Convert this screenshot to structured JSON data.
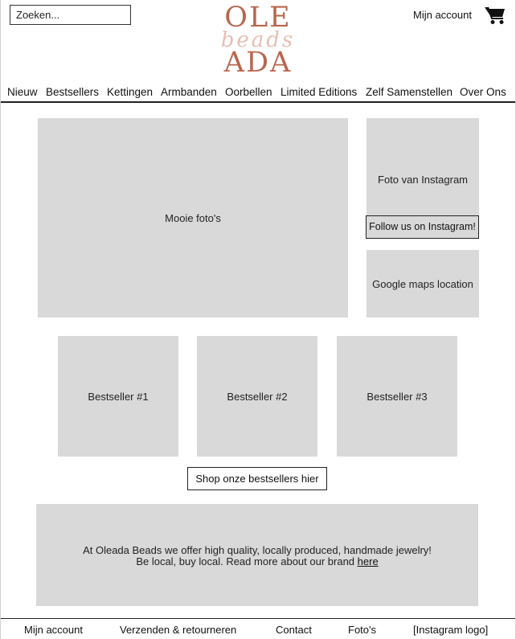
{
  "header": {
    "search": {
      "placeholder": "Zoeken..."
    },
    "logo": {
      "top": "OLE",
      "script": "beads",
      "bottom": "ADA"
    },
    "account_label": "Mijn account",
    "cart_icon": "shopping-cart-icon"
  },
  "nav": {
    "items": [
      {
        "label": "Nieuw"
      },
      {
        "label": "Bestsellers"
      },
      {
        "label": "Kettingen"
      },
      {
        "label": "Armbanden"
      },
      {
        "label": "Oorbellen"
      },
      {
        "label": "Limited Editions"
      },
      {
        "label": "Zelf Samenstellen"
      },
      {
        "label": "Over Ons"
      }
    ]
  },
  "main": {
    "hero_label": "Mooie foto's",
    "instagram": {
      "label": "Foto van Instagram",
      "button": "Follow us on Instagram!"
    },
    "maps_label": "Google maps location",
    "bestsellers": [
      {
        "label": "Bestseller #1"
      },
      {
        "label": "Bestseller #2"
      },
      {
        "label": "Bestseller #3"
      }
    ],
    "shop_button": "Shop onze bestsellers hier",
    "about": {
      "line1": "At Oleada Beads we offer high quality, locally produced, handmade jewelry!",
      "line2": "Be local, buy local. Read more about our brand",
      "link": "here"
    }
  },
  "footer": {
    "items": [
      {
        "label": "Mijn account"
      },
      {
        "label": "Verzenden & retourneren"
      },
      {
        "label": "Contact"
      },
      {
        "label": "Foto's"
      },
      {
        "label": "[Instagram logo]"
      }
    ]
  },
  "colors": {
    "brand": "#b8664e",
    "brand_light": "#e6bfb2",
    "placeholder_gray": "#d9d9d9",
    "text": "#111111"
  }
}
